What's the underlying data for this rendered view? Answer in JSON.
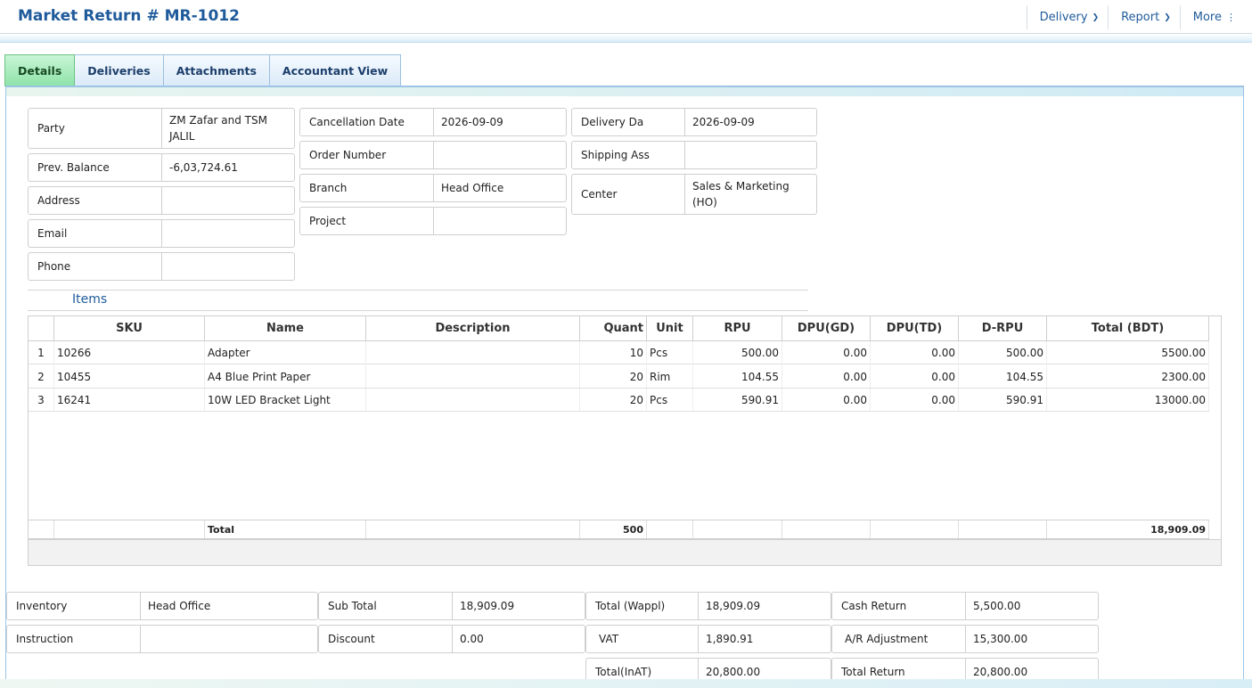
{
  "header": {
    "title": "Market Return # MR-1012",
    "menus": [
      {
        "label": "Delivery"
      },
      {
        "label": "Report"
      },
      {
        "label": "More"
      }
    ]
  },
  "tabs": [
    "Details",
    "Deliveries",
    "Attachments",
    "Accountant View"
  ],
  "party_fields": [
    {
      "label": "Party",
      "value": "ZM Zafar and TSM JALIL"
    },
    {
      "label": "Prev. Balance",
      "value": "-6,03,724.61"
    },
    {
      "label": "Address",
      "value": ""
    },
    {
      "label": "Email",
      "value": ""
    },
    {
      "label": "Phone",
      "value": ""
    }
  ],
  "order_fields": [
    {
      "label": "Cancellation Date",
      "value": "2026-09-09"
    },
    {
      "label": "Order Number",
      "value": ""
    },
    {
      "label": "Branch",
      "value": "Head Office"
    },
    {
      "label": "Project",
      "value": ""
    }
  ],
  "delivery_fields": [
    {
      "label": "Delivery Da",
      "value": "2026-09-09"
    },
    {
      "label": "Shipping Ass",
      "value": ""
    },
    {
      "label": "Center",
      "value": "Sales & Marketing (HO)"
    }
  ],
  "items": {
    "title": "Items",
    "columns": [
      "",
      "SKU",
      "Name",
      "Description",
      "Quant",
      "Unit",
      "RPU",
      "DPU(GD)",
      "DPU(TD)",
      "D-RPU",
      "Total (BDT)"
    ],
    "rows": [
      [
        "1",
        "10266",
        "Adapter",
        "",
        "10",
        "Pcs",
        "500.00",
        "0.00",
        "0.00",
        "500.00",
        "5500.00"
      ],
      [
        "2",
        "10455",
        "A4 Blue Print Paper",
        "",
        "20",
        "Rim",
        "104.55",
        "0.00",
        "0.00",
        "104.55",
        "2300.00"
      ],
      [
        "3",
        "16241",
        "10W LED Bracket Light",
        "",
        "20",
        "Pcs",
        "590.91",
        "0.00",
        "0.00",
        "590.91",
        "13000.00"
      ]
    ],
    "total_row": [
      "",
      "",
      "Total",
      "",
      "500",
      "",
      "",
      "",
      "",
      "",
      "18,909.09"
    ]
  },
  "summary": {
    "col1": [
      {
        "label": "Inventory",
        "value": "Head Office"
      },
      {
        "label": "Instruction",
        "value": ""
      }
    ],
    "col2": [
      {
        "label": "Sub Total",
        "value": "18,909.09"
      },
      {
        "label": "Discount",
        "value": "0.00"
      }
    ],
    "col3": [
      {
        "label": "Total (Wappl)",
        "value": "18,909.09"
      },
      {
        "label": "VAT",
        "value": "1,890.91"
      },
      {
        "label": "Total(InAT)",
        "value": "20,800.00"
      }
    ],
    "col4": [
      {
        "label": "Cash Return",
        "value": "5,500.00"
      },
      {
        "label": "A/R Adjustment",
        "value": "15,300.00"
      },
      {
        "label": "Total Return",
        "value": "20,800.00"
      }
    ]
  }
}
